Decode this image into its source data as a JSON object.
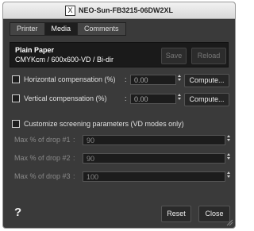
{
  "window": {
    "title": "NEO-Sun-FB3215-06DW2XL",
    "logo": "X"
  },
  "tabs": [
    {
      "label": "Printer",
      "active": false
    },
    {
      "label": "Media",
      "active": true
    },
    {
      "label": "Comments",
      "active": false
    }
  ],
  "media": {
    "paper_name": "Plain Paper",
    "paper_desc": "CMYKcm / 600x600-VD / Bi-dir",
    "save_label": "Save",
    "reload_label": "Reload"
  },
  "compensation": {
    "horizontal": {
      "label": "Horizontal compensation (%)",
      "colon": ":",
      "value": "0.00",
      "compute_label": "Compute..."
    },
    "vertical": {
      "label": "Vertical compensation (%)",
      "colon": ":",
      "value": "0.00",
      "compute_label": "Compute..."
    }
  },
  "screening": {
    "checkbox_label": "Customize screening parameters (VD modes only)",
    "drops": [
      {
        "label": "Max % of drop #1",
        "colon": ":",
        "value": "90"
      },
      {
        "label": "Max % of drop #2",
        "colon": ":",
        "value": "90"
      },
      {
        "label": "Max % of drop #3",
        "colon": ":",
        "value": "100"
      }
    ]
  },
  "footer": {
    "help_label": "?",
    "reset_label": "Reset",
    "close_label": "Close"
  }
}
